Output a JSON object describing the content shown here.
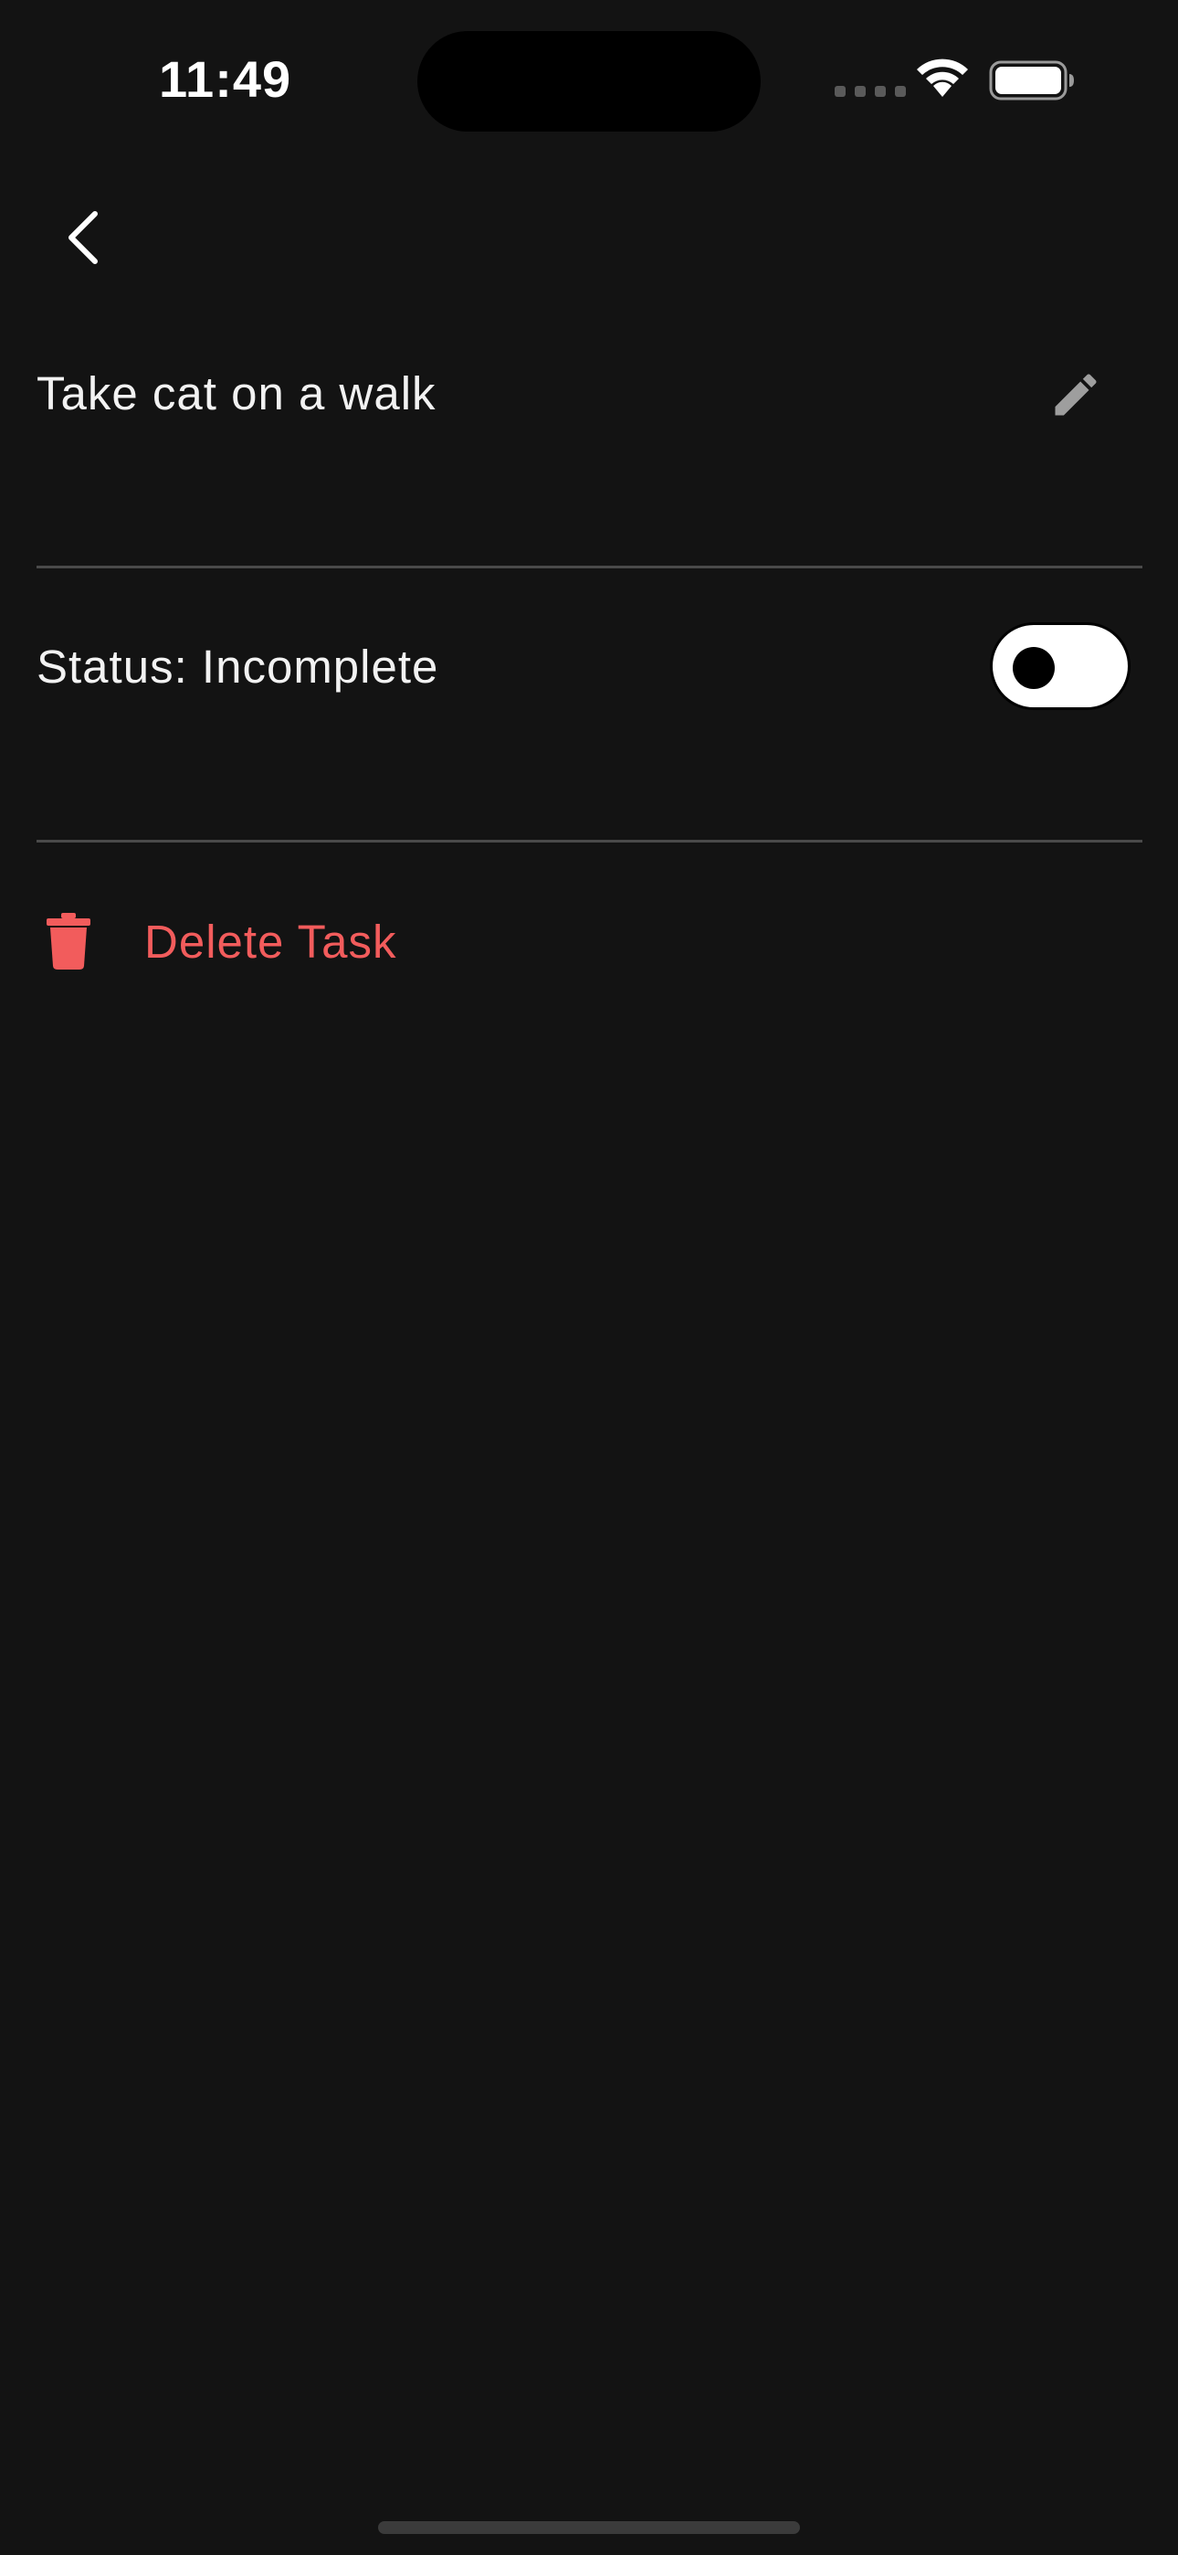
{
  "status_bar": {
    "time": "11:49"
  },
  "nav": {
    "back_icon": "chevron-left-icon"
  },
  "task": {
    "title": "Take cat on a walk",
    "edit_icon": "pencil-icon"
  },
  "status": {
    "label": "Status: Incomplete",
    "toggle_on": false
  },
  "delete": {
    "label": "Delete Task",
    "icon": "trash-icon",
    "color": "#f25c5c"
  },
  "colors": {
    "background": "#131313",
    "text": "#f2f2f2",
    "divider": "#4a4a4a",
    "danger": "#f25c5c"
  }
}
